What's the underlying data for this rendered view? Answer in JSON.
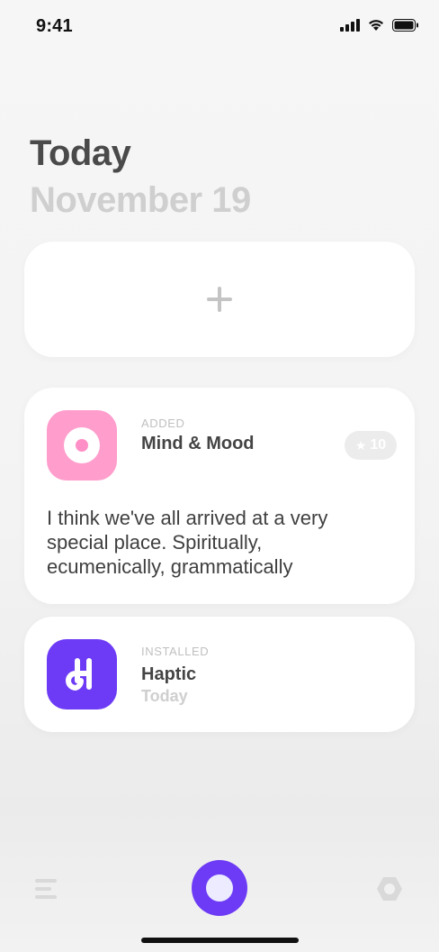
{
  "status_bar": {
    "time": "9:41",
    "icons": [
      "signal-icon",
      "wifi-icon",
      "battery-icon"
    ]
  },
  "header": {
    "title": "Today",
    "date": "November 19"
  },
  "add_card": {
    "icon": "plus-icon"
  },
  "entries": [
    {
      "label": "ADDED",
      "name": "Mind & Mood",
      "icon": "mind-mood-app-icon",
      "icon_color": "#ff9dcc",
      "rating": "10",
      "rating_icon": "star-icon",
      "text": "I think we've all arrived at a very special place. Spiritually, ecumenically, grammatically"
    },
    {
      "label": "INSTALLED",
      "name": "Haptic",
      "sub": "Today",
      "icon": "haptic-app-icon",
      "icon_color": "#6d3bf5"
    }
  ],
  "bottom_bar": {
    "left_icon": "menu-icon",
    "center_icon": "record-button",
    "right_icon": "settings-icon",
    "accent": "#6d3bf5"
  }
}
